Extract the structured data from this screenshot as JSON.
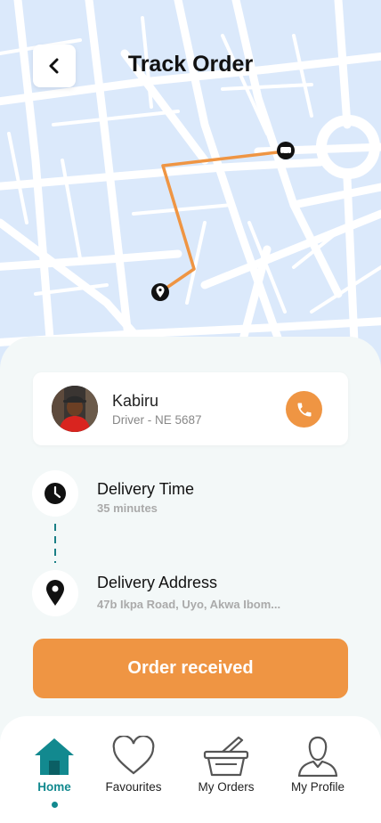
{
  "header": {
    "title": "Track Order"
  },
  "driver": {
    "name": "Kabiru",
    "subtitle": "Driver - NE 5687"
  },
  "delivery_time": {
    "label": "Delivery Time",
    "value": "35 minutes"
  },
  "delivery_address": {
    "label": "Delivery Address",
    "value": "47b Ikpa Road, Uyo, Akwa Ibom..."
  },
  "order_button": {
    "label": "Order received"
  },
  "nav": {
    "items": [
      {
        "label": "Home",
        "icon": "home-icon",
        "active": true
      },
      {
        "label": "Favourites",
        "icon": "heart-icon",
        "active": false
      },
      {
        "label": "My Orders",
        "icon": "basket-icon",
        "active": false
      },
      {
        "label": "My Profile",
        "icon": "profile-icon",
        "active": false
      }
    ]
  },
  "colors": {
    "accent": "#EF9543",
    "primary": "#12898F",
    "map_bg": "#DBE9FB"
  }
}
